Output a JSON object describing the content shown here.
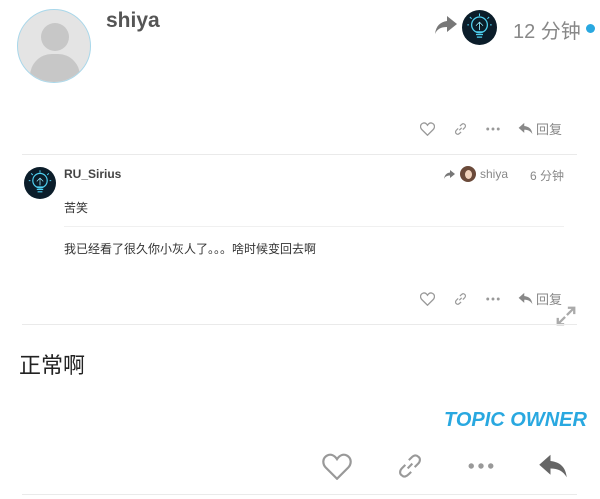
{
  "post": {
    "username": "shiya",
    "timestamp": "12 分钟",
    "reply_label": "回复",
    "owner_badge": "TOPIC OWNER",
    "content": "正常啊"
  },
  "quoted_reply": {
    "username": "RU_Sirius",
    "reply_to_username": "shiya",
    "timestamp": "6 分钟",
    "quote": "苦笑",
    "text": "我已经看了很久你小灰人了。。。啥时候变回去啊",
    "reply_label": "回复"
  },
  "colors": {
    "accent": "#29a8e0",
    "muted": "#999999"
  }
}
